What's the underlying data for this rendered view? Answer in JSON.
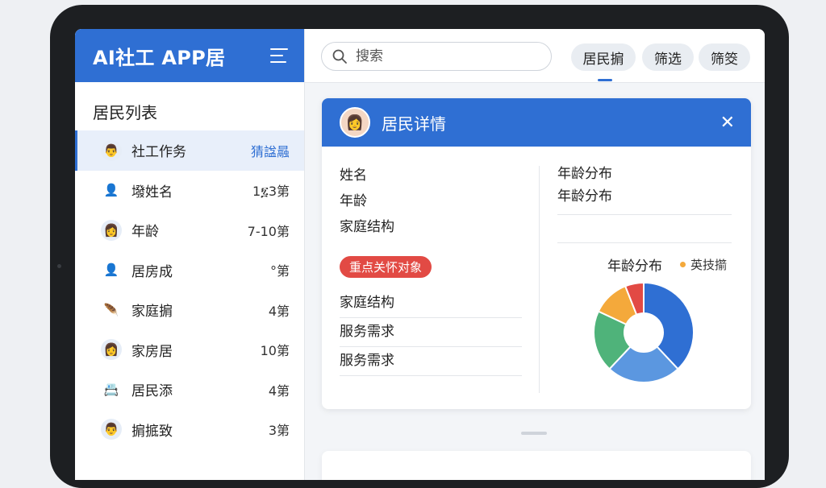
{
  "app": {
    "title": "AI社工 APP居"
  },
  "sidebar": {
    "list_title": "居民列表",
    "items": [
      {
        "name": "社工作务",
        "value": "猜諡曧",
        "icon": "person-male-avatar-icon",
        "active": true
      },
      {
        "name": "墢姓名",
        "value": "1፯3第",
        "icon": "person-gray-icon"
      },
      {
        "name": "年龄",
        "value": "7-10第",
        "icon": "person-female-avatar-icon"
      },
      {
        "name": "居房成",
        "value": "°第",
        "icon": "person-gray-icon"
      },
      {
        "name": "家庭掮",
        "value": "4第",
        "icon": "feather-icon"
      },
      {
        "name": "家房居",
        "value": "10第",
        "icon": "person-female-avatar-icon"
      },
      {
        "name": "居民添",
        "value": "4第",
        "icon": "calendar-card-icon"
      },
      {
        "name": "掮掋致",
        "value": "3第",
        "icon": "person-male-avatar-icon"
      }
    ]
  },
  "topbar": {
    "search_placeholder": "搜索",
    "chips": [
      "居民掮",
      "筛选",
      "筛筊"
    ]
  },
  "detail": {
    "title": "居民详情",
    "fields": [
      "姓名",
      "年龄",
      "家庭结构"
    ],
    "badge": "重点关怀对象",
    "list": [
      "家庭结构",
      "服务需求",
      "服务需求"
    ],
    "right_fields": [
      "年龄分布",
      "年龄分布"
    ],
    "chart_title": "年龄分布",
    "legend_label": "英技擶"
  },
  "colors": {
    "primary": "#2f6fd3",
    "badge": "#e24a44",
    "legend_dot": "#f4a93b"
  },
  "chart_data": {
    "type": "pie",
    "title": "年龄分布",
    "legend": [
      "英技擶"
    ],
    "values": [
      38,
      24,
      20,
      12,
      6
    ],
    "colors": [
      "#2f6fd3",
      "#5b97e0",
      "#4fb37a",
      "#f4a93b",
      "#e24a44"
    ]
  }
}
